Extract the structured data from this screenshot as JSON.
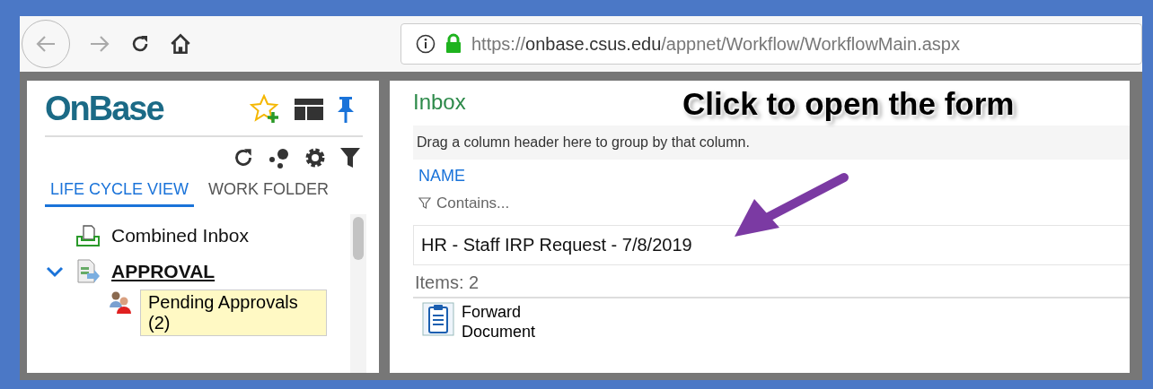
{
  "browser": {
    "url": {
      "scheme": "https://",
      "host": "onbase.csus.edu",
      "path": "/appnet/Workflow/WorkflowMain.aspx"
    }
  },
  "sidebar": {
    "logo": "OnBase",
    "tabs": [
      {
        "label": "LIFE CYCLE VIEW",
        "selected": true
      },
      {
        "label": "WORK FOLDER",
        "selected": false
      }
    ],
    "tree": [
      {
        "label": "Combined Inbox",
        "kind": "inbox"
      },
      {
        "label": "APPROVAL",
        "kind": "lifecycle",
        "expanded": true,
        "children": [
          {
            "label": "Pending Approvals (2)",
            "kind": "queue",
            "selected": true
          }
        ]
      }
    ]
  },
  "main": {
    "title": "Inbox",
    "group_hint": "Drag a column header here to group by that column.",
    "columns": [
      {
        "label": "NAME",
        "filter_placeholder": "Contains..."
      }
    ],
    "rows": [
      {
        "name": "HR - Staff IRP Request - 7/8/2019"
      }
    ],
    "items_count": "Items: 2",
    "tasks": [
      {
        "label": "Forward Document"
      }
    ],
    "annotation": "Click to open the form"
  }
}
